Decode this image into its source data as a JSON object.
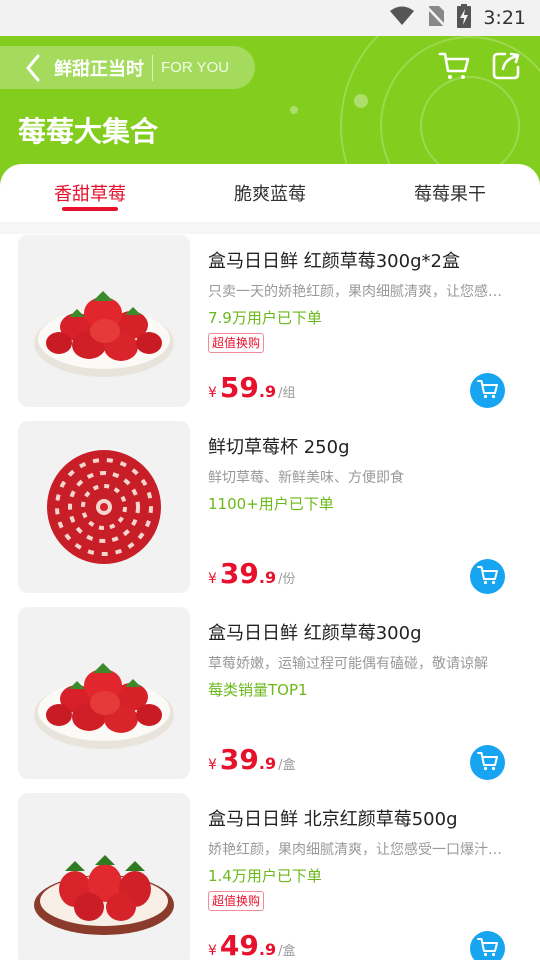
{
  "status_bar": {
    "time": "3:21"
  },
  "header": {
    "back_title": "鲜甜正当时",
    "back_subtitle": "FOR YOU",
    "page_title": "莓莓大集合"
  },
  "tabs": [
    {
      "label": "香甜草莓",
      "active": true
    },
    {
      "label": "脆爽蓝莓",
      "active": false
    },
    {
      "label": "莓莓果干",
      "active": false
    }
  ],
  "colors": {
    "header_green": "#82cd1e",
    "accent_red": "#e8112d",
    "sales_green": "#6bb91a",
    "cart_blue": "#17a5f2"
  },
  "products": [
    {
      "name": "盒马日日鲜 红颜草莓300g*2盒",
      "desc": "只卖一天的娇艳红颜，果肉细腻清爽，让您感受一口爆汁的甜蜜",
      "sales": "7.9万用户已下单",
      "badge": "超值换购",
      "currency": "¥",
      "price_int": "59",
      "price_dec": ".9",
      "unit": "/组",
      "image": "strawberry-plate-image"
    },
    {
      "name": "鲜切草莓杯 250g",
      "desc": "鲜切草莓、新鲜美味、方便即食",
      "sales": "1100+用户已下单",
      "badge": "",
      "currency": "¥",
      "price_int": "39",
      "price_dec": ".9",
      "unit": "/份",
      "image": "cut-strawberry-cup-image"
    },
    {
      "name": "盒马日日鲜 红颜草莓300g",
      "desc": "草莓娇嫩，运输过程可能偶有磕碰，敬请谅解",
      "sales": "莓类销量TOP1",
      "badge": "",
      "currency": "¥",
      "price_int": "39",
      "price_dec": ".9",
      "unit": "/盒",
      "image": "strawberry-plate-image"
    },
    {
      "name": "盒马日日鲜 北京红颜草莓500g",
      "desc": "娇艳红颜，果肉细腻清爽，让您感受一口爆汁的甜蜜",
      "sales": "1.4万用户已下单",
      "badge": "超值换购",
      "currency": "¥",
      "price_int": "49",
      "price_dec": ".9",
      "unit": "/盒",
      "image": "strawberry-dish-image"
    }
  ]
}
